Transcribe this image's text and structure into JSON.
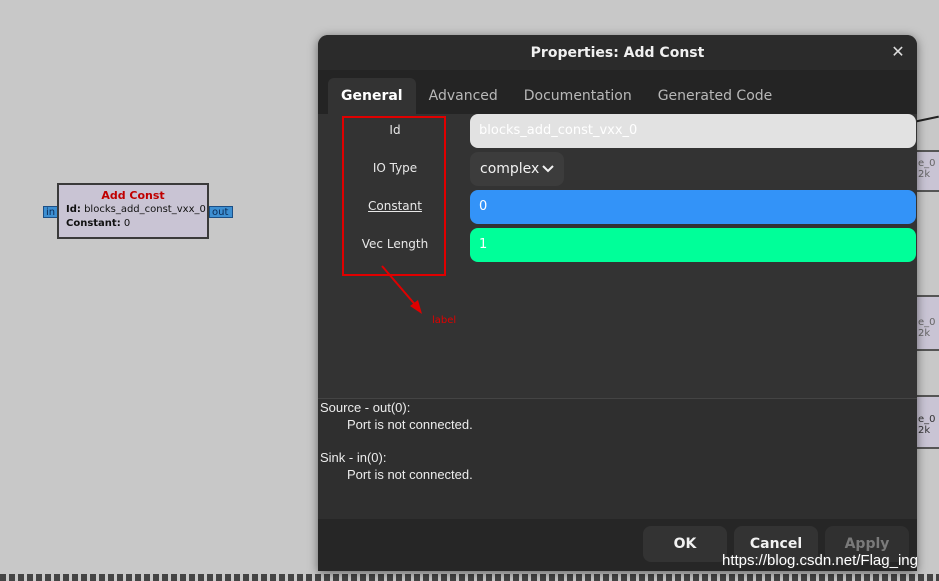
{
  "flowgraph": {
    "block": {
      "title": "Add Const",
      "id_label": "Id:",
      "id_value": "blocks_add_const_vxx_0",
      "constant_label": "Constant:",
      "constant_value": "0",
      "port_in": "in",
      "port_out": "out"
    },
    "bg_blocks": [
      {
        "line1": "e_0",
        "line2": "2k"
      },
      {
        "line1": "e_0",
        "line2": "2k"
      },
      {
        "line1": "e_0",
        "line2": "2k"
      }
    ]
  },
  "dialog": {
    "title": "Properties: Add Const",
    "close_symbol": "✕",
    "tabs": [
      {
        "label": "General",
        "active": true
      },
      {
        "label": "Advanced",
        "active": false
      },
      {
        "label": "Documentation",
        "active": false
      },
      {
        "label": "Generated Code",
        "active": false
      }
    ],
    "params": {
      "id": {
        "label": "Id",
        "value": "blocks_add_const_vxx_0"
      },
      "io_type": {
        "label": "IO Type",
        "value": "complex"
      },
      "constant": {
        "label": "Constant",
        "value": "0"
      },
      "vec_length": {
        "label": "Vec Length",
        "value": "1"
      }
    },
    "annotation": {
      "text": "label",
      "color": "#e00000"
    },
    "ports": {
      "source_header": "Source - out(0):",
      "source_status": "Port is not connected.",
      "sink_header": "Sink - in(0):",
      "sink_status": "Port is not connected."
    },
    "buttons": {
      "ok": "OK",
      "cancel": "Cancel",
      "apply": "Apply"
    }
  },
  "watermark": "https://blog.csdn.net/Flag_ing",
  "colors": {
    "constant_field": "#3393f8",
    "veclen_field": "#00ff99",
    "block_title": "#c00000",
    "dialog_bg": "#2f2f2f"
  }
}
